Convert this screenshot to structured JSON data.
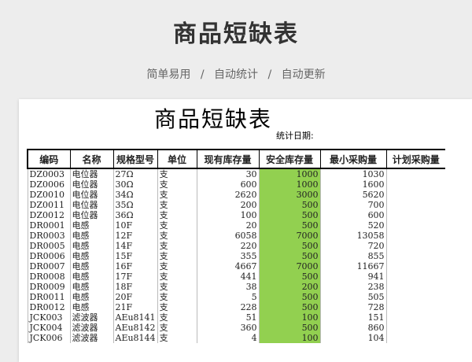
{
  "header": {
    "title": "商品短缺表",
    "subtitle_items": [
      "简单易用",
      "自动统计",
      "自动更新"
    ],
    "separator": "/"
  },
  "sheet": {
    "title": "商品短缺表",
    "stat_date_label": "统计日期:",
    "columns": [
      "编码",
      "名称",
      "规格型号",
      "单位",
      "现有库存量",
      "安全库存量",
      "最小采购量",
      "计划采购量"
    ],
    "rows": [
      [
        "DZ0003",
        "电位器",
        "27Ω",
        "支",
        "30",
        "1000",
        "1030",
        ""
      ],
      [
        "DZ0006",
        "电位器",
        "30Ω",
        "支",
        "600",
        "1000",
        "1600",
        ""
      ],
      [
        "DZ0010",
        "电位器",
        "34Ω",
        "支",
        "2620",
        "3000",
        "5620",
        ""
      ],
      [
        "DZ0011",
        "电位器",
        "35Ω",
        "支",
        "200",
        "500",
        "700",
        ""
      ],
      [
        "DZ0012",
        "电位器",
        "36Ω",
        "支",
        "100",
        "500",
        "600",
        ""
      ],
      [
        "DR0001",
        "电感",
        "10F",
        "支",
        "20",
        "500",
        "520",
        ""
      ],
      [
        "DR0003",
        "电感",
        "12F",
        "支",
        "6058",
        "7000",
        "13058",
        ""
      ],
      [
        "DR0005",
        "电感",
        "14F",
        "支",
        "220",
        "500",
        "720",
        ""
      ],
      [
        "DR0006",
        "电感",
        "15F",
        "支",
        "355",
        "500",
        "855",
        ""
      ],
      [
        "DR0007",
        "电感",
        "16F",
        "支",
        "4667",
        "7000",
        "11667",
        ""
      ],
      [
        "DR0008",
        "电感",
        "17F",
        "支",
        "441",
        "500",
        "941",
        ""
      ],
      [
        "DR0009",
        "电感",
        "18F",
        "支",
        "38",
        "200",
        "238",
        ""
      ],
      [
        "DR0011",
        "电感",
        "20F",
        "支",
        "5",
        "500",
        "505",
        ""
      ],
      [
        "DR0012",
        "电感",
        "21F",
        "支",
        "228",
        "500",
        "728",
        ""
      ],
      [
        "JCK003",
        "滤波器",
        "AEu8141",
        "支",
        "51",
        "100",
        "151",
        ""
      ],
      [
        "JCK004",
        "滤波器",
        "AEu8142",
        "支",
        "360",
        "500",
        "860",
        ""
      ],
      [
        "JCK006",
        "滤波器",
        "AEu8144",
        "支",
        "4",
        "100",
        "104",
        ""
      ]
    ]
  },
  "colors": {
    "safe_stock_fill": "#92d050",
    "background": "#ededed"
  }
}
